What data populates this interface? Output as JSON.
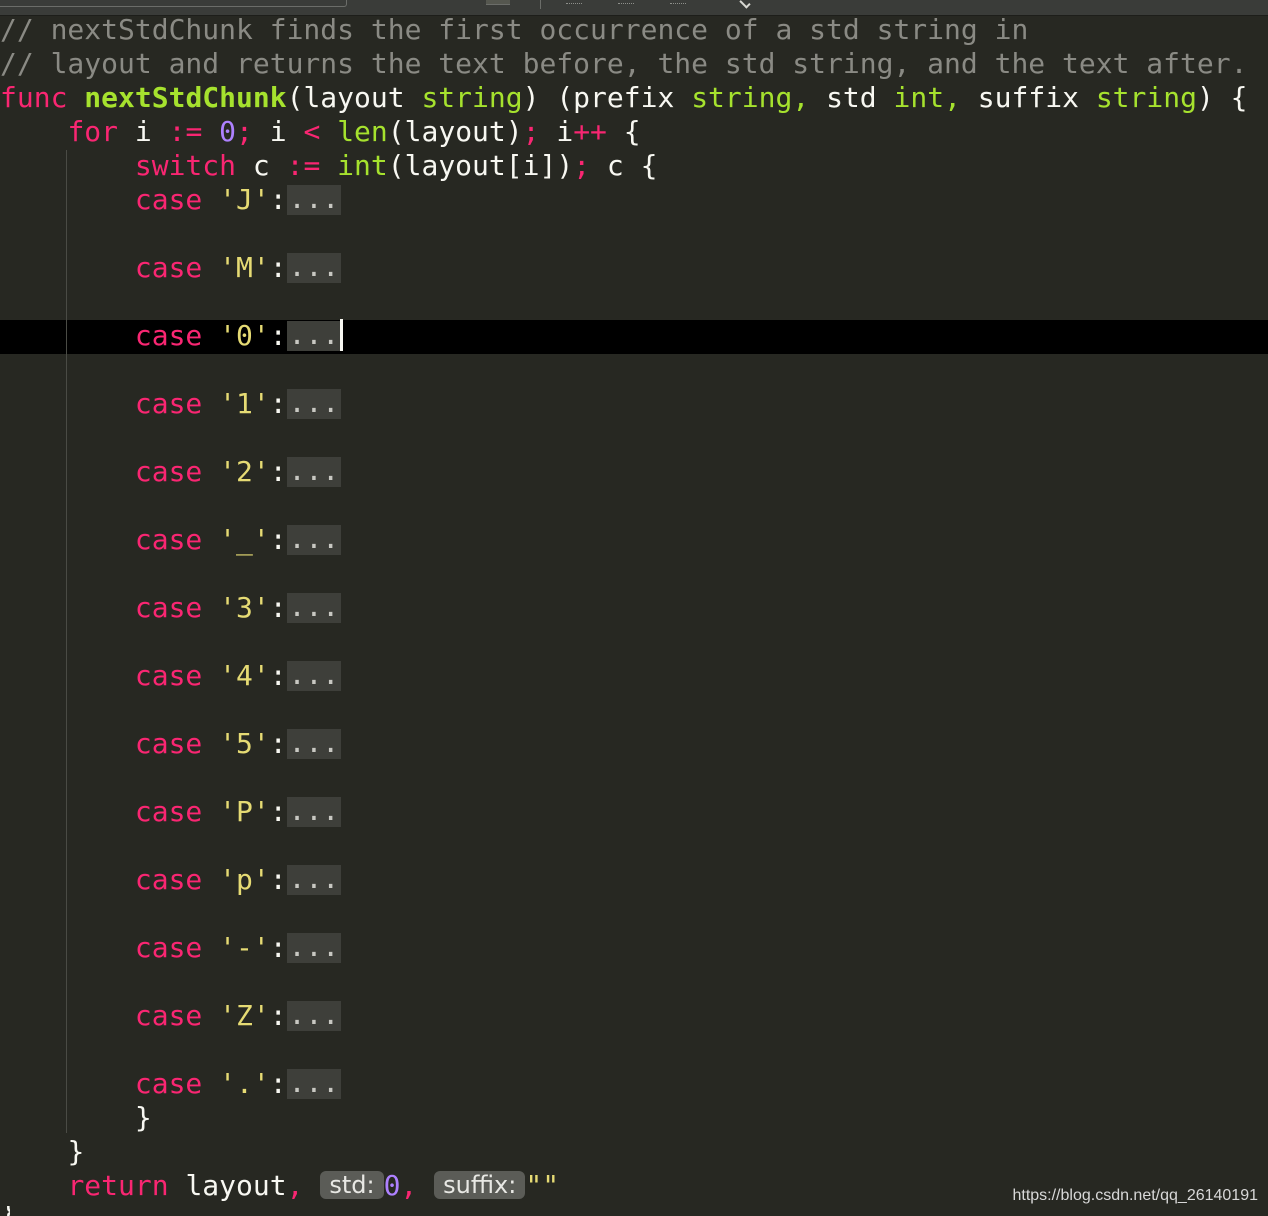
{
  "editor": {
    "comment_1": "// nextStdChunk finds the first occurrence of a std string in",
    "comment_2": "// layout and returns the text before, the std string, and the text after.",
    "func_kw": "func",
    "func_name": "nextStdChunk",
    "p_open": "(layout ",
    "string_type": "string",
    "p_mid": ") (prefix ",
    "p_std": "std ",
    "int_type": "int",
    "p_suffix": "suffix ",
    "p_close": ") {",
    "comma": ",",
    "for_kw": "for",
    "i_var": " i ",
    "assign_op": ":=",
    "zero": "0",
    "semicolon": ";",
    "lt_op": "<",
    "len_fn": "len",
    "len_args": "(layout)",
    "inc_var": " i",
    "inc_op": "++",
    "open_brace": " {",
    "switch_kw": "switch",
    "c_var": " c ",
    "int_fn": "int",
    "int_args": "(layout[i])",
    "switch_tail": " c {",
    "case_kw": "case",
    "colon": ":",
    "fold_text": "...",
    "cases": [
      "'J'",
      "'M'",
      "'0'",
      "'1'",
      "'2'",
      "'_'",
      "'3'",
      "'4'",
      "'5'",
      "'P'",
      "'p'",
      "'-'",
      "'Z'",
      "'.'"
    ],
    "close_brace": "}",
    "return_kw": "return",
    "return_layout": " layout",
    "hint_std": "std:",
    "hint_suffix": "suffix:",
    "empty_string": "\"\""
  },
  "watermark": "https://blog.csdn.net/qq_26140191"
}
